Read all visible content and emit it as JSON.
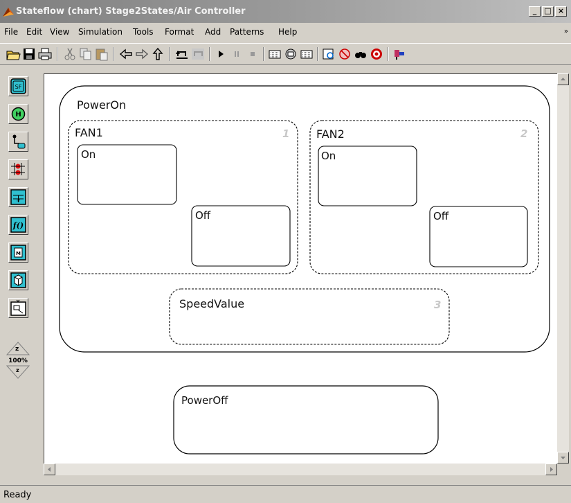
{
  "window": {
    "title": "Stateflow (chart) Stage2States/Air Controller",
    "controls": {
      "minimize": "_",
      "maximize": "□",
      "close": "×"
    }
  },
  "menu": {
    "items": [
      "File",
      "Edit",
      "View",
      "Simulation",
      "Tools",
      "Format",
      "Add",
      "Patterns",
      "Help"
    ],
    "overflow_glyph": "»"
  },
  "toolbar": {
    "buttons": [
      "open-icon",
      "save-icon",
      "print-icon",
      "cut-icon",
      "copy-icon",
      "paste-icon",
      "back-icon",
      "forward-icon",
      "up-icon",
      "undo-icon",
      "redo-icon",
      "start-icon",
      "pause-icon",
      "stop-icon",
      "build-icon",
      "rebuild-icon",
      "data-icon",
      "explorer-icon",
      "debug-icon",
      "find-icon",
      "target-icon",
      "model-icon"
    ]
  },
  "palette": {
    "tools": [
      "state-tool-icon",
      "history-junction-icon",
      "default-transition-icon",
      "connective-junction-icon",
      "truth-table-icon",
      "graphical-function-icon",
      "matlab-function-icon",
      "simulink-function-icon",
      "box-tool-icon"
    ],
    "zoom": {
      "label": "100%",
      "in": "z",
      "out": "z"
    }
  },
  "chart": {
    "states": [
      {
        "id": "PowerOn",
        "label": "PowerOn"
      },
      {
        "id": "FAN1",
        "label": "FAN1",
        "order": "1"
      },
      {
        "id": "FAN1_On",
        "label": "On"
      },
      {
        "id": "FAN1_Off",
        "label": "Off"
      },
      {
        "id": "FAN2",
        "label": "FAN2",
        "order": "2"
      },
      {
        "id": "FAN2_On",
        "label": "On"
      },
      {
        "id": "FAN2_Off",
        "label": "Off"
      },
      {
        "id": "SpeedValue",
        "label": "SpeedValue",
        "order": "3"
      },
      {
        "id": "PowerOff",
        "label": "PowerOff"
      }
    ]
  },
  "status": {
    "text": "Ready"
  },
  "colors": {
    "titlebar_start": "#7f7f7f",
    "face": "#d4d0c8",
    "canvas": "#ffffff",
    "order_label": "#c8c8c8"
  }
}
